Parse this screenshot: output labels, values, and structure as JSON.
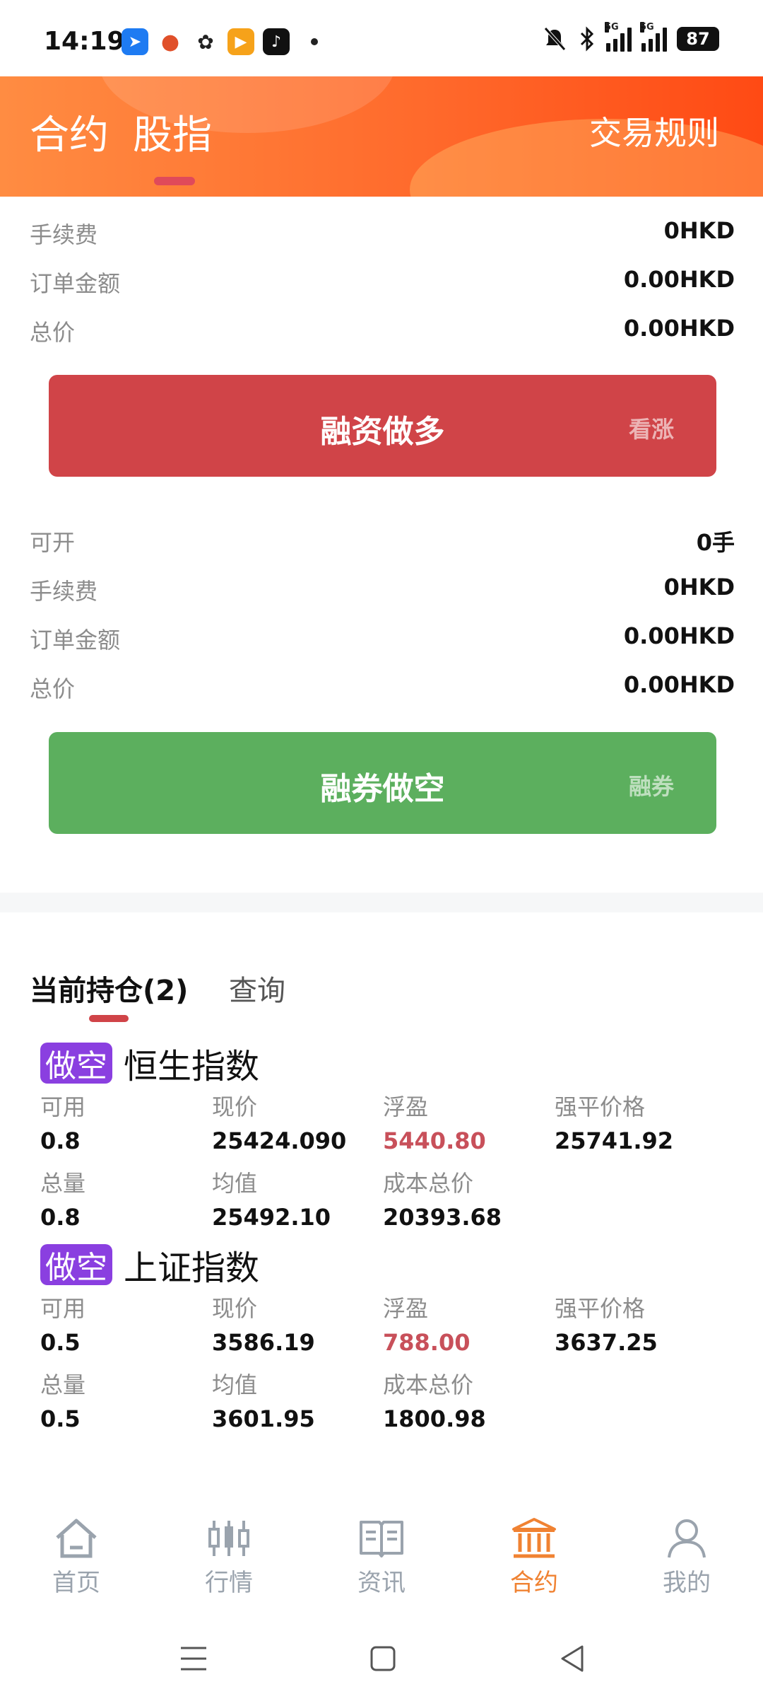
{
  "status_bar": {
    "time": "14:19",
    "battery": "87",
    "network_1": "5G",
    "network_2": "5G",
    "icons": [
      "notification-muted-icon",
      "bluetooth-icon"
    ]
  },
  "header": {
    "tabs": [
      "合约",
      "股指"
    ],
    "active_tab": "股指",
    "rules_link": "交易规则"
  },
  "long_panel": {
    "rows": [
      {
        "label": "手续费",
        "value": "0HKD"
      },
      {
        "label": "订单金额",
        "value": "0.00HKD"
      },
      {
        "label": "总价",
        "value": "0.00HKD"
      }
    ],
    "button_label": "融资做多",
    "button_side_label": "看涨",
    "color": "#d04448"
  },
  "short_panel": {
    "rows": [
      {
        "label": "可开",
        "value": "0手"
      },
      {
        "label": "手续费",
        "value": "0HKD"
      },
      {
        "label": "订单金额",
        "value": "0.00HKD"
      },
      {
        "label": "总价",
        "value": "0.00HKD"
      }
    ],
    "button_label": "融券做空",
    "button_side_label": "融券",
    "color": "#5caf5e"
  },
  "positions": {
    "tab_current": "当前持仓(2)",
    "tab_query": "查询",
    "items": [
      {
        "direction": "做空",
        "name": "恒生指数",
        "available_label": "可用",
        "available": "0.8",
        "price_label": "现价",
        "price": "25424.090",
        "pnl_label": "浮盈",
        "pnl": "5440.80",
        "liq_label": "强平价格",
        "liq_price": "25741.92",
        "total_label": "总量",
        "total": "0.8",
        "avg_label": "均值",
        "avg": "25492.10",
        "cost_label": "成本总价",
        "cost": "20393.68"
      },
      {
        "direction": "做空",
        "name": "上证指数",
        "available_label": "可用",
        "available": "0.5",
        "price_label": "现价",
        "price": "3586.19",
        "pnl_label": "浮盈",
        "pnl": "788.00",
        "liq_label": "强平价格",
        "liq_price": "3637.25",
        "total_label": "总量",
        "total": "0.5",
        "avg_label": "均值",
        "avg": "3601.95",
        "cost_label": "成本总价",
        "cost": "1800.98"
      }
    ]
  },
  "bottom_nav": {
    "items": [
      {
        "label": "首页",
        "icon": "home-icon"
      },
      {
        "label": "行情",
        "icon": "candlestick-icon"
      },
      {
        "label": "资讯",
        "icon": "book-icon"
      },
      {
        "label": "合约",
        "icon": "bank-icon"
      },
      {
        "label": "我的",
        "icon": "user-icon"
      }
    ],
    "active": "合约",
    "active_color": "#f08232",
    "inactive_color": "#9aa3ad"
  }
}
